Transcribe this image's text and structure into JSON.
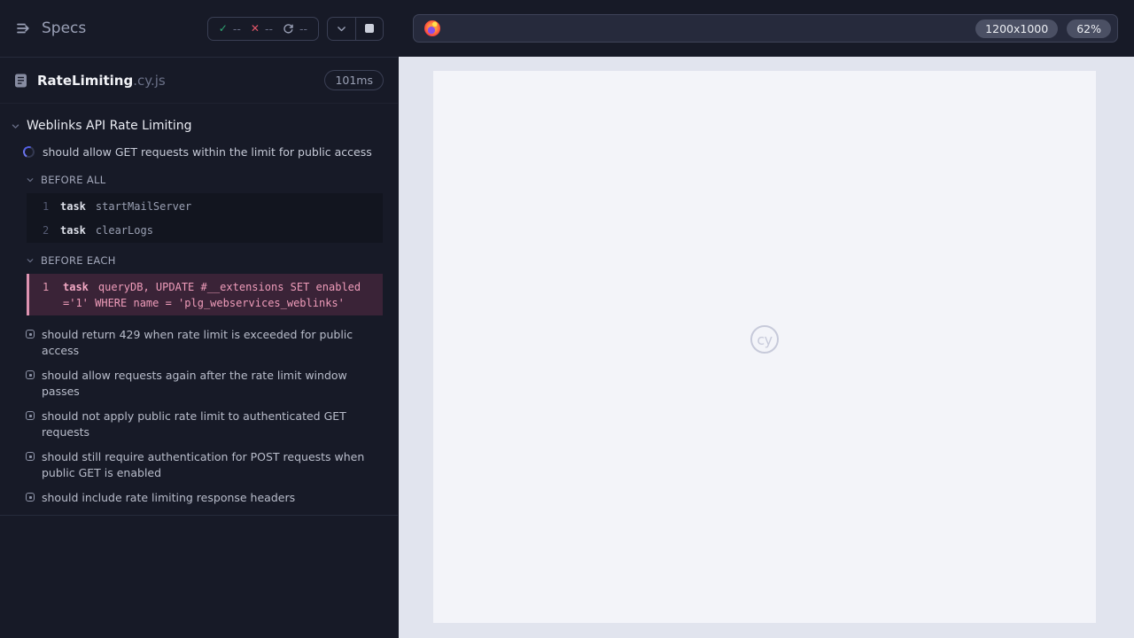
{
  "sidebar": {
    "title": "Specs",
    "stats": {
      "passed": "--",
      "failed": "--",
      "running": "--"
    },
    "spec": {
      "name": "RateLimiting",
      "extension": ".cy.js",
      "duration": "101ms"
    },
    "suite": {
      "title": "Weblinks API Rate Limiting",
      "running_test": "should allow GET requests within the limit for public access",
      "before_all": {
        "label": "BEFORE ALL",
        "commands": [
          {
            "n": "1",
            "method": "task",
            "message": "startMailServer"
          },
          {
            "n": "2",
            "method": "task",
            "message": "clearLogs"
          }
        ]
      },
      "before_each": {
        "label": "BEFORE EACH",
        "commands": [
          {
            "n": "1",
            "method": "task",
            "message": "queryDB, UPDATE #__extensions SET enabled ='1' WHERE name = 'plg_webservices_weblinks'"
          }
        ]
      },
      "pending_tests": [
        "should return 429 when rate limit is exceeded for public access",
        "should allow requests again after the rate limit window passes",
        "should not apply public rate limit to authenticated GET requests",
        "should still require authentication for POST requests when public GET is enabled",
        "should include rate limiting response headers"
      ]
    }
  },
  "browser": {
    "url": "",
    "viewport_size": "1200x1000",
    "zoom_level": "62%",
    "watermark": "cy"
  },
  "colors": {
    "passed_green": "#2fa874",
    "failed_red": "#e25668",
    "running_blue": "#5460e4",
    "highlight_pink": "#ef9cba",
    "sidebar_bg": "#171a27",
    "viewport_bg": "#f3f4f9"
  }
}
